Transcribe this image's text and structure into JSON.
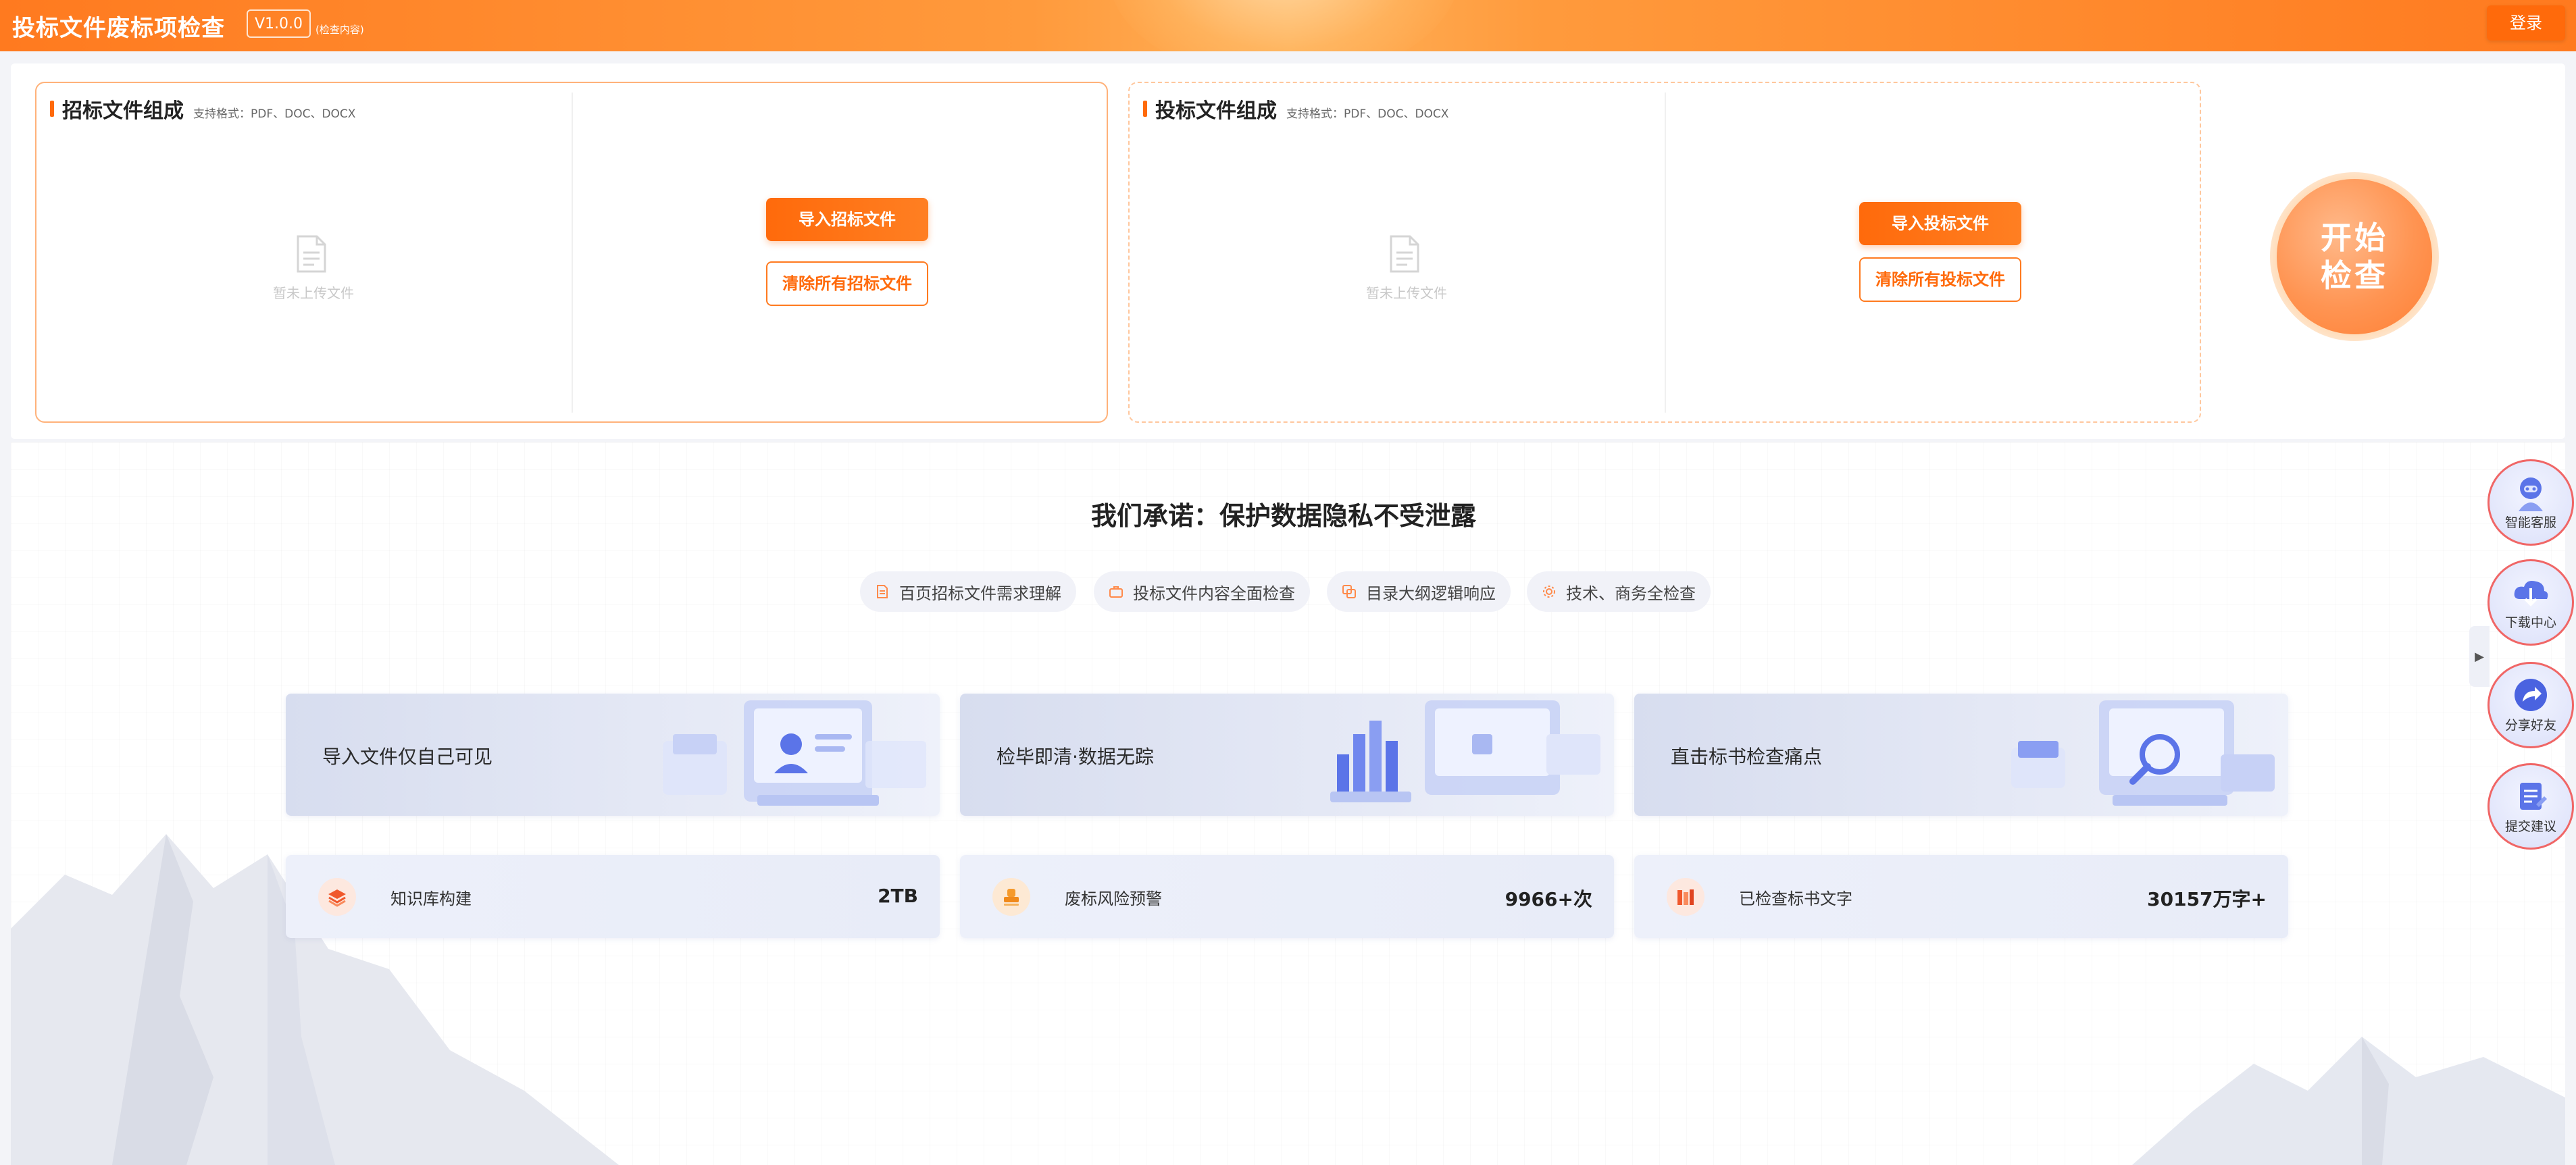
{
  "header": {
    "title": "投标文件废标项检查",
    "version": "V1.0.0",
    "note": "(检查内容)",
    "login_label": "登录"
  },
  "tender_card": {
    "title": "招标文件组成",
    "formats": "支持格式：PDF、DOC、DOCX",
    "empty_text": "暂未上传文件",
    "import_label": "导入招标文件",
    "clear_label": "清除所有招标文件"
  },
  "bid_card": {
    "title": "投标文件组成",
    "formats": "支持格式：PDF、DOC、DOCX",
    "empty_text": "暂未上传文件",
    "import_label": "导入投标文件",
    "clear_label": "清除所有投标文件"
  },
  "start": {
    "line1": "开始",
    "line2": "检查"
  },
  "promise": "我们承诺：保护数据隐私不受泄露",
  "tags": [
    {
      "label": "百页招标文件需求理解",
      "icon": "document-icon"
    },
    {
      "label": "投标文件内容全面检查",
      "icon": "briefcase-icon"
    },
    {
      "label": "目录大纲逻辑响应",
      "icon": "copy-icon"
    },
    {
      "label": "技术、商务全检查",
      "icon": "gear-icon"
    }
  ],
  "features": [
    {
      "label": "导入文件仅自己可见",
      "icon": "user-monitor-illustration"
    },
    {
      "label": "检毕即清·数据无踪",
      "icon": "chart-monitor-illustration"
    },
    {
      "label": "直击标书检查痛点",
      "icon": "magnifier-monitor-illustration"
    }
  ],
  "stats": [
    {
      "label": "知识库构建",
      "value": "2TB",
      "icon": "layers-icon"
    },
    {
      "label": "废标风险预警",
      "value": "9966+次",
      "icon": "stamp-icon"
    },
    {
      "label": "已检查标书文字",
      "value": "30157万字+",
      "icon": "books-icon"
    }
  ],
  "sidebar": [
    {
      "label": "智能客服",
      "icon": "robot-icon"
    },
    {
      "label": "下载中心",
      "icon": "download-icon"
    },
    {
      "label": "分享好友",
      "icon": "share-icon"
    },
    {
      "label": "提交建议",
      "icon": "suggestion-icon"
    }
  ],
  "colors": {
    "accent": "#ff6a0b",
    "accent_light": "#ff9a3c",
    "sidebar_border": "#f06666"
  }
}
